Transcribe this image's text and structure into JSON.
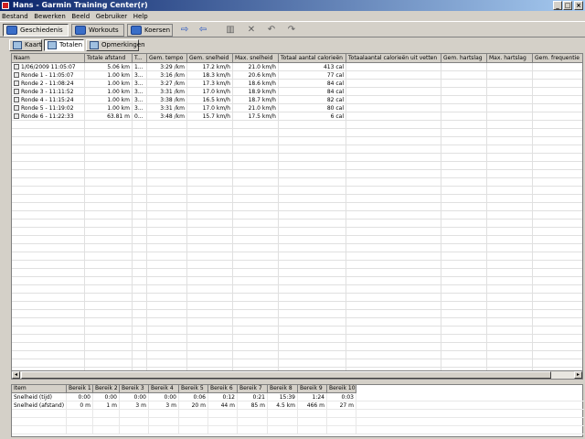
{
  "window": {
    "title": "Hans - Garmin Training Center(r)"
  },
  "menu": [
    "Bestand",
    "Bewerken",
    "Beeld",
    "Gebruiker",
    "Help"
  ],
  "toolbar": {
    "tabs": [
      {
        "label": "Geschiedenis",
        "active": true
      },
      {
        "label": "Workouts",
        "active": false
      },
      {
        "label": "Koersen",
        "active": false
      }
    ]
  },
  "subtabs": [
    {
      "label": "Kaart",
      "active": false
    },
    {
      "label": "Totalen",
      "active": true
    },
    {
      "label": "Opmerkingen",
      "active": false
    }
  ],
  "table": {
    "columns": [
      "Naam",
      "Totale afstand",
      "T...",
      "Gem. tempo",
      "Gem. snelheid",
      "Max. snelheid",
      "Totaal aantal calorieën",
      "Totaalaantal calorieën uit vetten",
      "Gem. hartslag",
      "Max. hartslag",
      "Gem. frequentie"
    ],
    "rows": [
      [
        "1/06/2009 11:05:07",
        "5.06 km",
        "1...",
        "3:29 /km",
        "17.2 km/h",
        "21.0 km/h",
        "413 cal"
      ],
      [
        "Ronde 1 - 11:05:07",
        "1.00 km",
        "3...",
        "3:16 /km",
        "18.3 km/h",
        "20.6 km/h",
        "77 cal"
      ],
      [
        "Ronde 2 - 11:08:24",
        "1.00 km",
        "3...",
        "3:27 /km",
        "17.3 km/h",
        "18.6 km/h",
        "84 cal"
      ],
      [
        "Ronde 3 - 11:11:52",
        "1.00 km",
        "3...",
        "3:31 /km",
        "17.0 km/h",
        "18.9 km/h",
        "84 cal"
      ],
      [
        "Ronde 4 - 11:15:24",
        "1.00 km",
        "3...",
        "3:38 /km",
        "16.5 km/h",
        "18.7 km/h",
        "82 cal"
      ],
      [
        "Ronde 5 - 11:19:02",
        "1.00 km",
        "3...",
        "3:31 /km",
        "17.0 km/h",
        "21.0 km/h",
        "80 cal"
      ],
      [
        "Ronde 6 - 11:22:33",
        "63.81 m",
        "0...",
        "3:48 /km",
        "15.7 km/h",
        "17.5 km/h",
        "6 cal"
      ]
    ]
  },
  "zones": {
    "columns": [
      "Item",
      "Bereik 1",
      "Bereik 2",
      "Bereik 3",
      "Bereik 4",
      "Bereik 5",
      "Bereik 6",
      "Bereik 7",
      "Bereik 8",
      "Bereik 9",
      "Bereik 10"
    ],
    "rows": [
      [
        "Snelheid (tijd)",
        "0:00",
        "0:00",
        "0:00",
        "0:00",
        "0:06",
        "0:12",
        "0:21",
        "15:39",
        "1:24",
        "0:03"
      ],
      [
        "Snelheid (afstand)",
        "0 m",
        "1 m",
        "3 m",
        "3 m",
        "20 m",
        "44 m",
        "85 m",
        "4.5 km",
        "466 m",
        "27 m"
      ]
    ]
  }
}
